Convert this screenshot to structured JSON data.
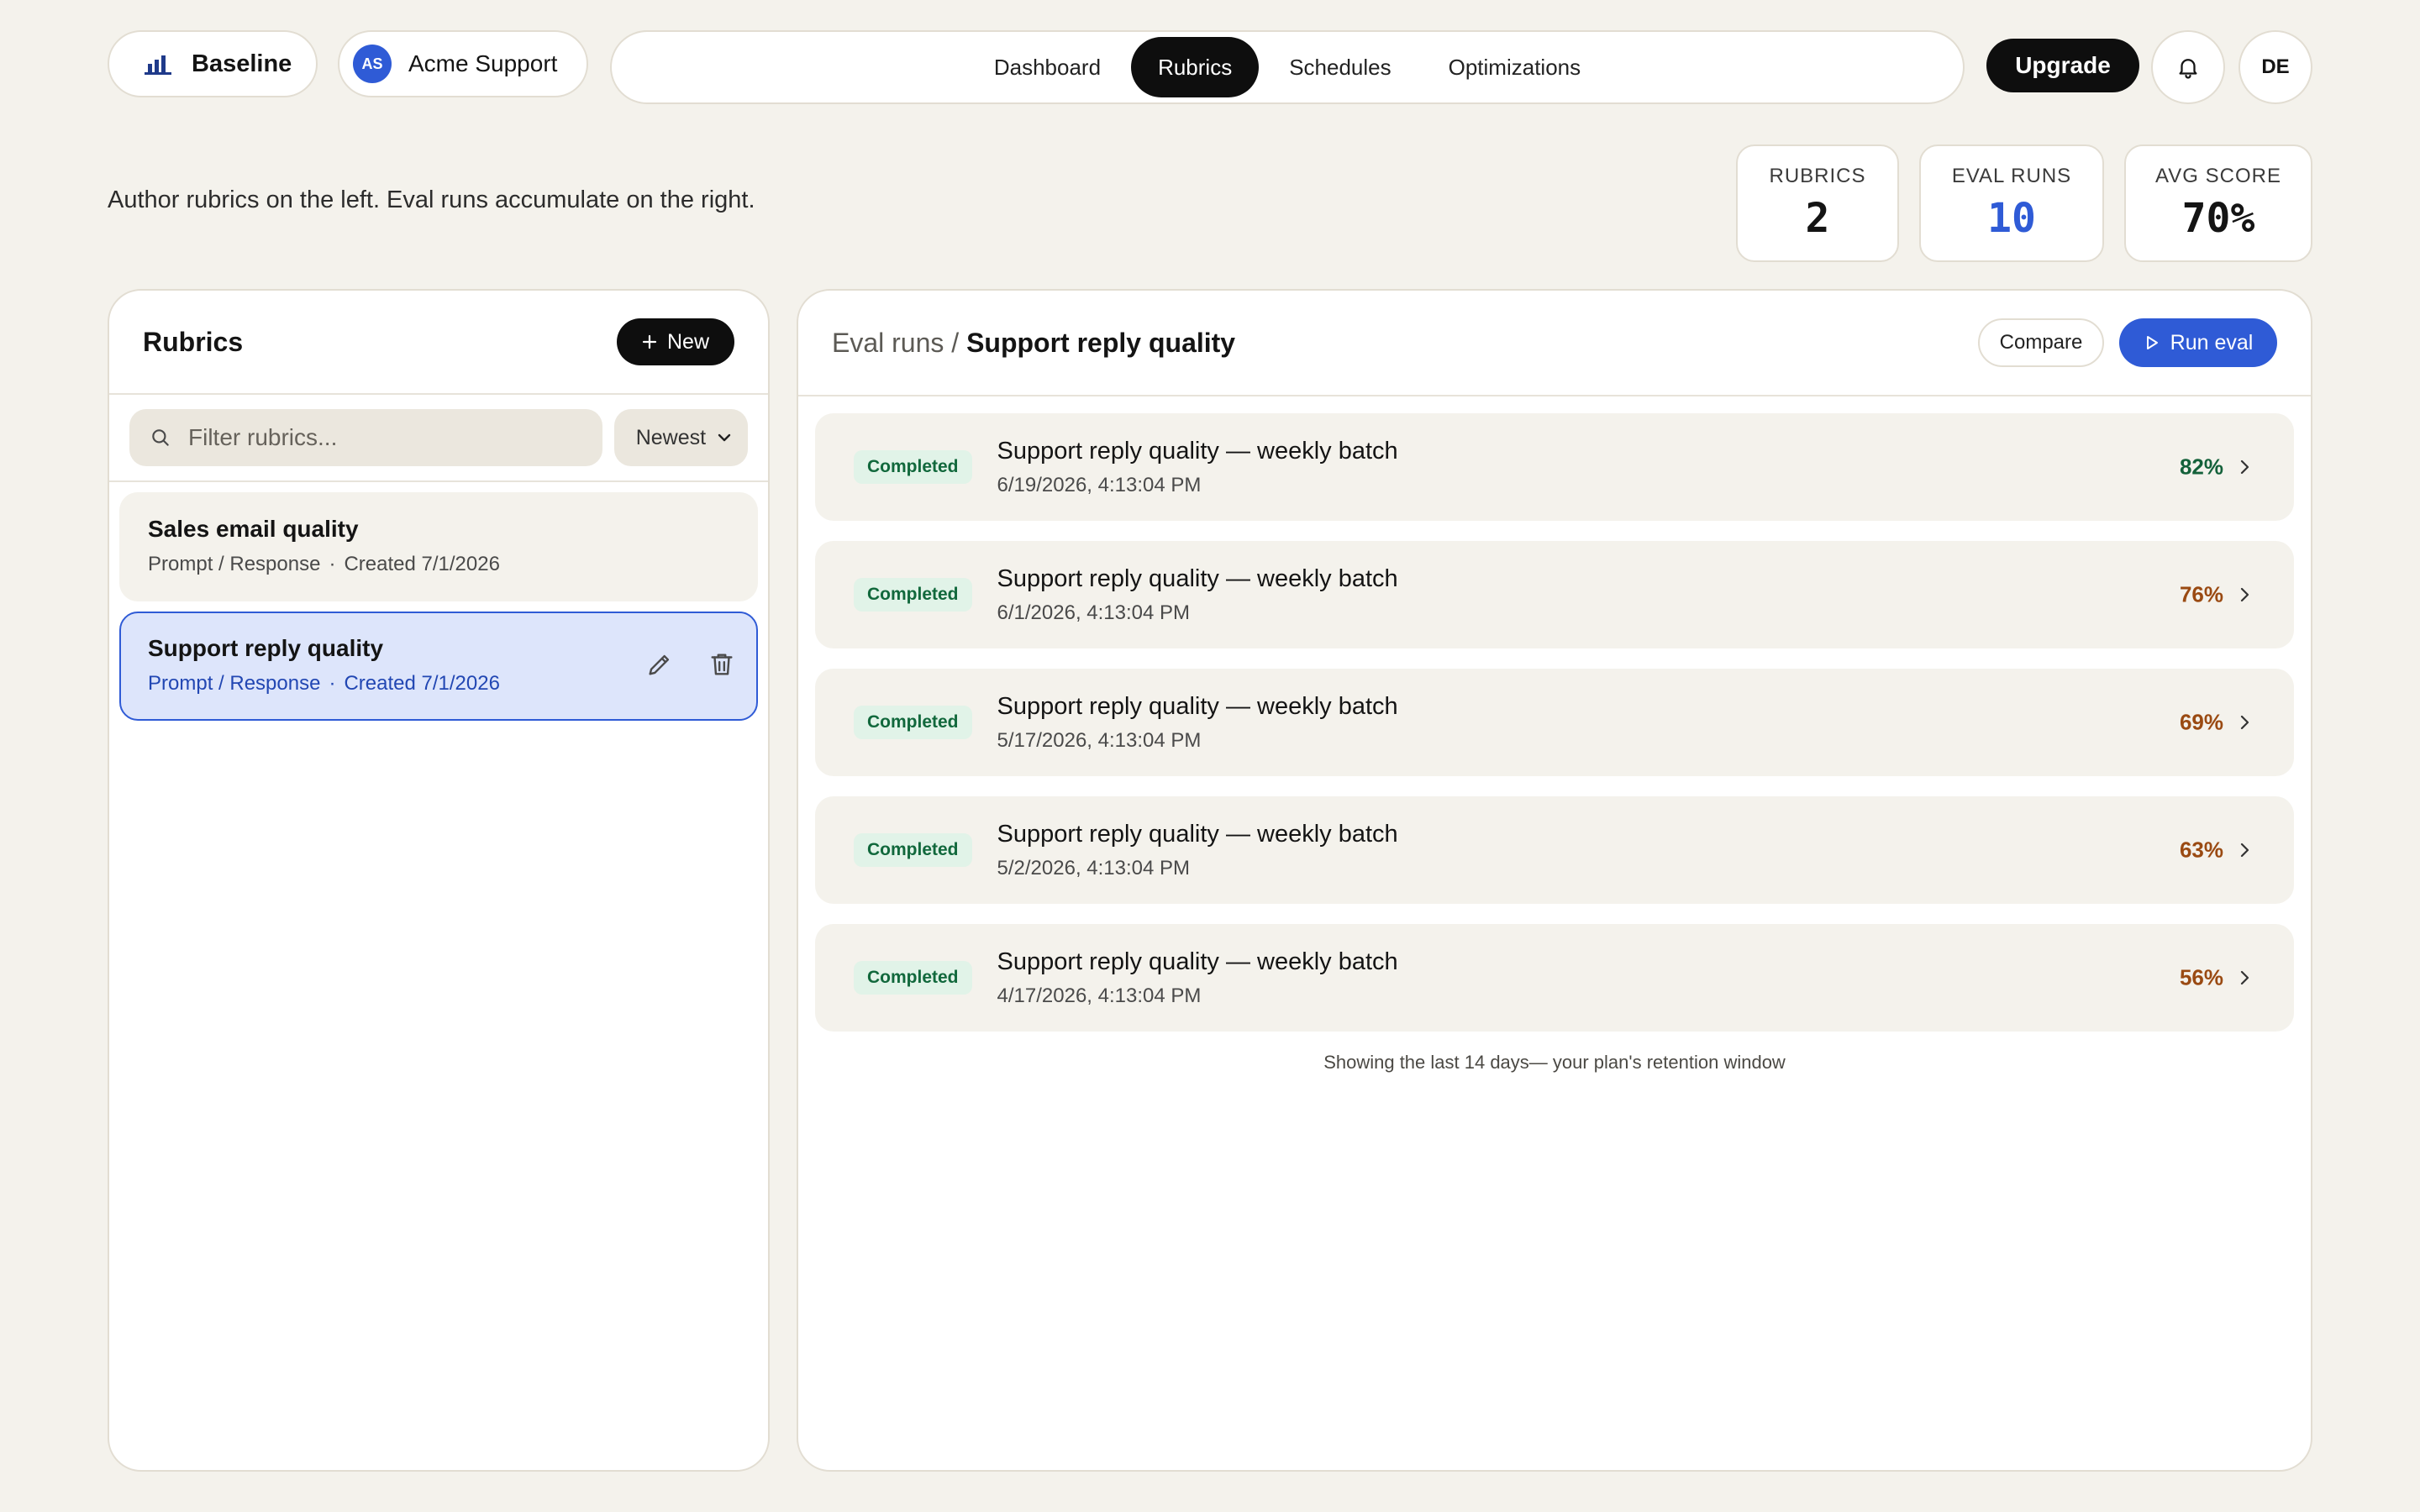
{
  "header": {
    "brand": "Baseline",
    "workspace": {
      "initials": "AS",
      "name": "Acme Support"
    },
    "nav": [
      {
        "label": "Dashboard",
        "active": false
      },
      {
        "label": "Rubrics",
        "active": true
      },
      {
        "label": "Schedules",
        "active": false
      },
      {
        "label": "Optimizations",
        "active": false
      }
    ],
    "upgrade_label": "Upgrade",
    "user_initials": "DE"
  },
  "intro": "Author rubrics on the left. Eval runs accumulate on the right.",
  "stats": {
    "rubrics": {
      "label": "RUBRICS",
      "value": "2"
    },
    "eval_runs": {
      "label": "EVAL RUNS",
      "value": "10"
    },
    "avg_score": {
      "label": "AVG SCORE",
      "value": "70%"
    }
  },
  "rubrics_panel": {
    "title": "Rubrics",
    "new_label": "New",
    "search_placeholder": "Filter rubrics...",
    "sort_value": "Newest",
    "items": [
      {
        "name": "Sales email quality",
        "type": "Prompt / Response",
        "created": "Created 7/1/2026",
        "selected": false
      },
      {
        "name": "Support reply quality",
        "type": "Prompt / Response",
        "created": "Created 7/1/2026",
        "selected": true
      }
    ]
  },
  "runs_panel": {
    "breadcrumb_parent": "Eval runs",
    "breadcrumb_sep": "/",
    "breadcrumb_current": "Support reply quality",
    "compare_label": "Compare",
    "run_label": "Run eval",
    "runs": [
      {
        "status": "Completed",
        "title": "Support reply quality — weekly batch",
        "timestamp": "6/19/2026, 4:13:04 PM",
        "score": "82%",
        "score_color": "#14613a"
      },
      {
        "status": "Completed",
        "title": "Support reply quality — weekly batch",
        "timestamp": "6/1/2026, 4:13:04 PM",
        "score": "76%",
        "score_color": "#9a4a12"
      },
      {
        "status": "Completed",
        "title": "Support reply quality — weekly batch",
        "timestamp": "5/17/2026, 4:13:04 PM",
        "score": "69%",
        "score_color": "#9a4a12"
      },
      {
        "status": "Completed",
        "title": "Support reply quality — weekly batch",
        "timestamp": "5/2/2026, 4:13:04 PM",
        "score": "63%",
        "score_color": "#9a4a12"
      },
      {
        "status": "Completed",
        "title": "Support reply quality — weekly batch",
        "timestamp": "4/17/2026, 4:13:04 PM",
        "score": "56%",
        "score_color": "#9a4a12"
      }
    ],
    "retention_note": "Showing the last 14 days— your plan's retention window"
  },
  "colors": {
    "accent": "#2f5bd6",
    "background": "#f4f2ec",
    "dark": "#0e0e0e",
    "success_badge": "#e1f3e8"
  }
}
